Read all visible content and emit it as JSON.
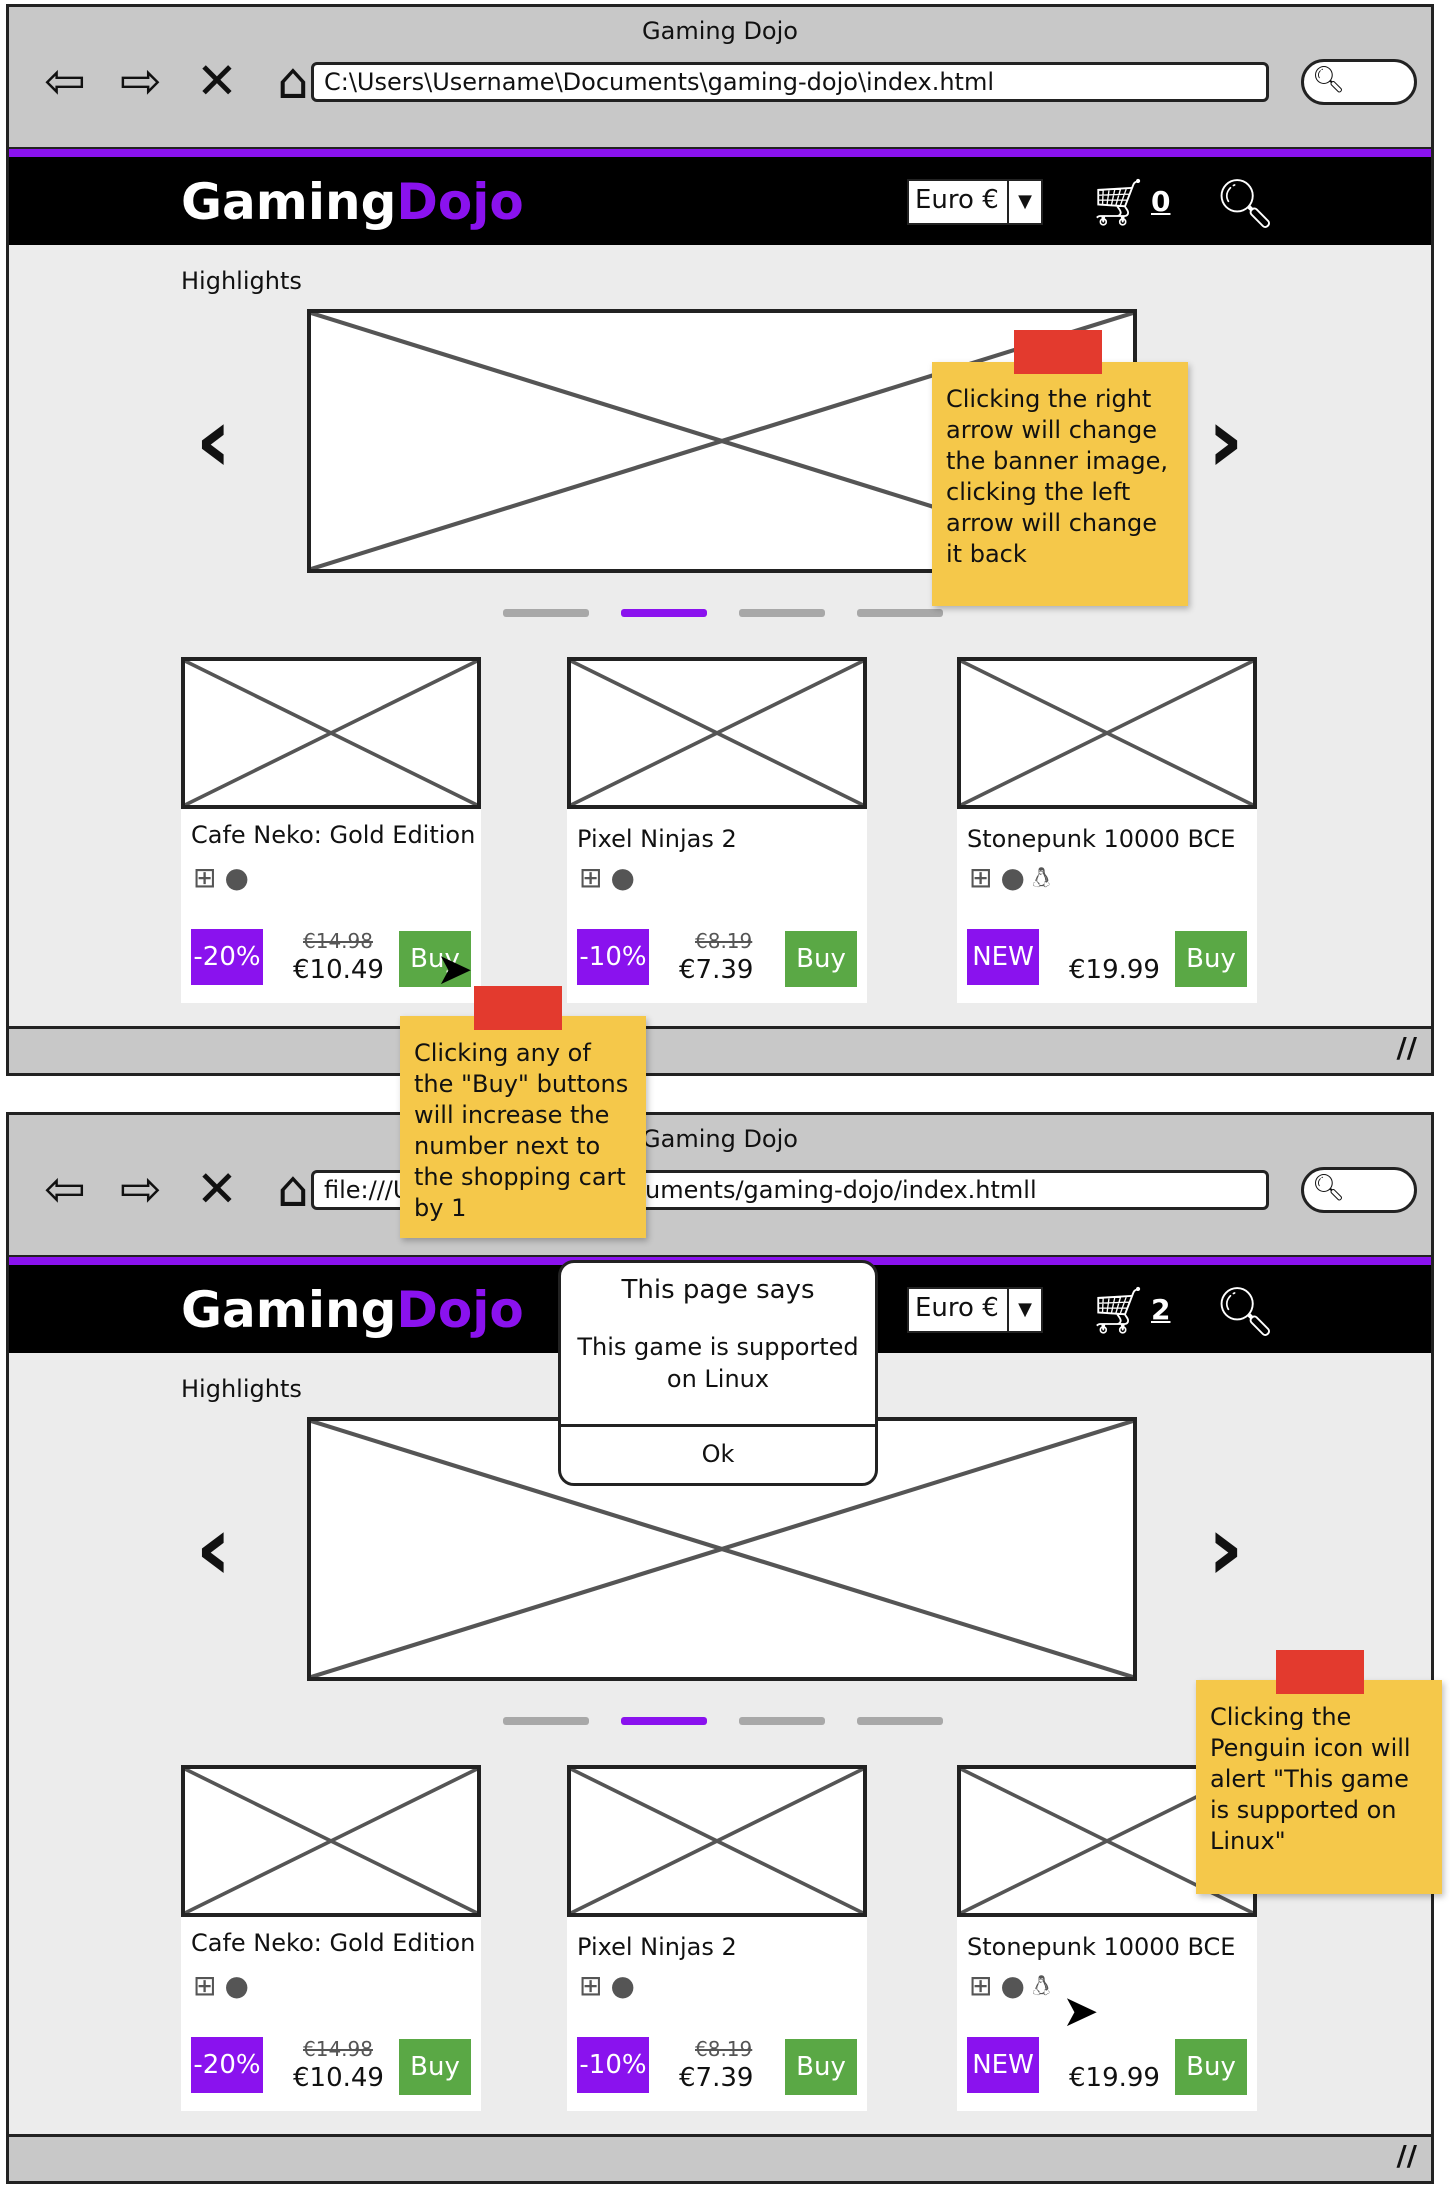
{
  "colors": {
    "accent": "#8a12ee",
    "buy": "#5aa845",
    "note": "#f5c84a",
    "tape": "#e33a2e"
  },
  "windows": [
    {
      "title": "Gaming Dojo",
      "address": "C:\\Users\\Username\\Documents\\gaming-dojo\\index.html",
      "cart_count": "0"
    },
    {
      "title": "Gaming Dojo",
      "address": "file:///Users/Username/Documents/gaming-dojo/index.htmll",
      "cart_count": "2"
    }
  ],
  "nav_icons": [
    "back-icon",
    "forward-icon",
    "stop-icon",
    "home-icon"
  ],
  "site": {
    "logo_part1": "Gaming",
    "logo_part2": "Dojo",
    "currency": "Euro €",
    "highlights": "Highlights"
  },
  "products": [
    {
      "name": "Cafe Neko: Gold Edition",
      "badge": "-20%",
      "old_price": "€14.98",
      "price": "€10.49",
      "buy": "Buy",
      "platforms": [
        "windows-icon",
        "apple-icon"
      ]
    },
    {
      "name": "Pixel Ninjas 2",
      "badge": "-10%",
      "old_price": "€8.19",
      "price": "€7.39",
      "buy": "Buy",
      "platforms": [
        "windows-icon",
        "apple-icon"
      ]
    },
    {
      "name": "Stonepunk 10000 BCE",
      "badge": "NEW",
      "old_price": "",
      "price": "€19.99",
      "buy": "Buy",
      "platforms": [
        "windows-icon",
        "apple-icon",
        "linux-icon"
      ]
    }
  ],
  "notes": {
    "arrow": "Clicking the right arrow will change the banner image, clicking the left arrow will change it back",
    "buy": "Clicking any of the \"Buy\" buttons will increase the number next to the shopping cart by 1",
    "penguin": "Clicking the Penguin icon will alert \"This game is supported on Linux\""
  },
  "dialog": {
    "title": "This page says",
    "message": "This game is supported on Linux",
    "ok": "Ok"
  }
}
